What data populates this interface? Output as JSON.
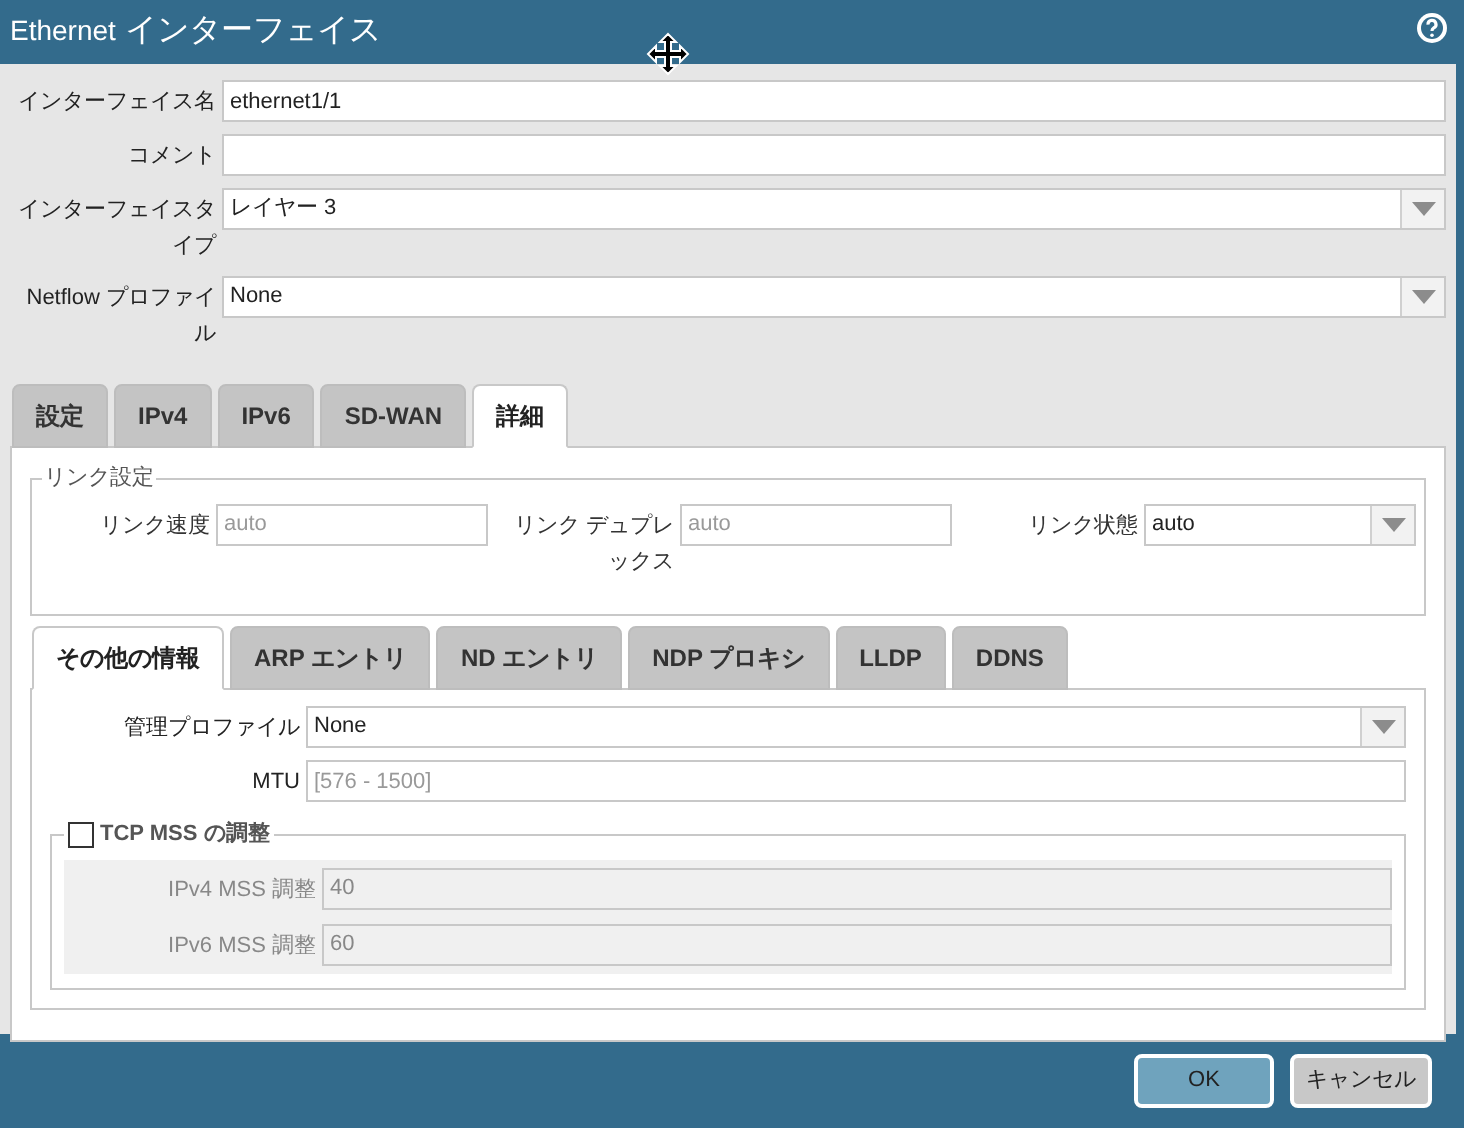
{
  "window": {
    "title_prefix": "Ethernet",
    "title": "インターフェイス"
  },
  "fields": [
    {
      "label": "インターフェイス名",
      "kind": "text",
      "value": "ethernet1/1"
    },
    {
      "label": "コメント",
      "kind": "text"
    },
    {
      "label": "インターフェイスタイプ",
      "kind": "select",
      "value": "レイヤー 3"
    },
    {
      "label": "Netflow プロファイル",
      "kind": "select",
      "value": "None"
    }
  ],
  "tabs": [
    {
      "label": "設定",
      "selected": false
    },
    {
      "label": "IPv4",
      "selected": false
    },
    {
      "label": "IPv6",
      "selected": false
    },
    {
      "label": "SD-WAN",
      "selected": false
    },
    {
      "label": "詳細",
      "selected": true
    }
  ],
  "link_settings": {
    "legend": "リンク設定",
    "fields": [
      {
        "label": "リンク速度",
        "kind": "text",
        "placeholder": "auto"
      },
      {
        "label": "リンク デュプレックス",
        "kind": "text",
        "placeholder": "auto"
      },
      {
        "label": "リンク状態",
        "kind": "select",
        "value": "auto"
      }
    ]
  },
  "subtabs": [
    {
      "label": "その他の情報",
      "selected": true
    },
    {
      "label": "ARP エントリ",
      "selected": false
    },
    {
      "label": "ND エントリ",
      "selected": false
    },
    {
      "label": "NDP プロキシ",
      "selected": false
    },
    {
      "label": "LLDP",
      "selected": false
    },
    {
      "label": "DDNS",
      "selected": false
    }
  ],
  "other_fields": [
    {
      "label": "管理プロファイル",
      "kind": "select",
      "value": "None"
    },
    {
      "label": "MTU",
      "kind": "text",
      "placeholder": "[576 - 1500]"
    }
  ],
  "tcp_mss": {
    "label": "TCP MSS の調整",
    "checked": false,
    "fields": [
      {
        "label": "IPv4 MSS 調整",
        "value": "40"
      },
      {
        "label": "IPv6 MSS 調整",
        "value": "60"
      }
    ]
  },
  "buttons": [
    {
      "label": "OK",
      "kind": "primary"
    },
    {
      "label": "キャンセル",
      "kind": "secondary"
    }
  ]
}
